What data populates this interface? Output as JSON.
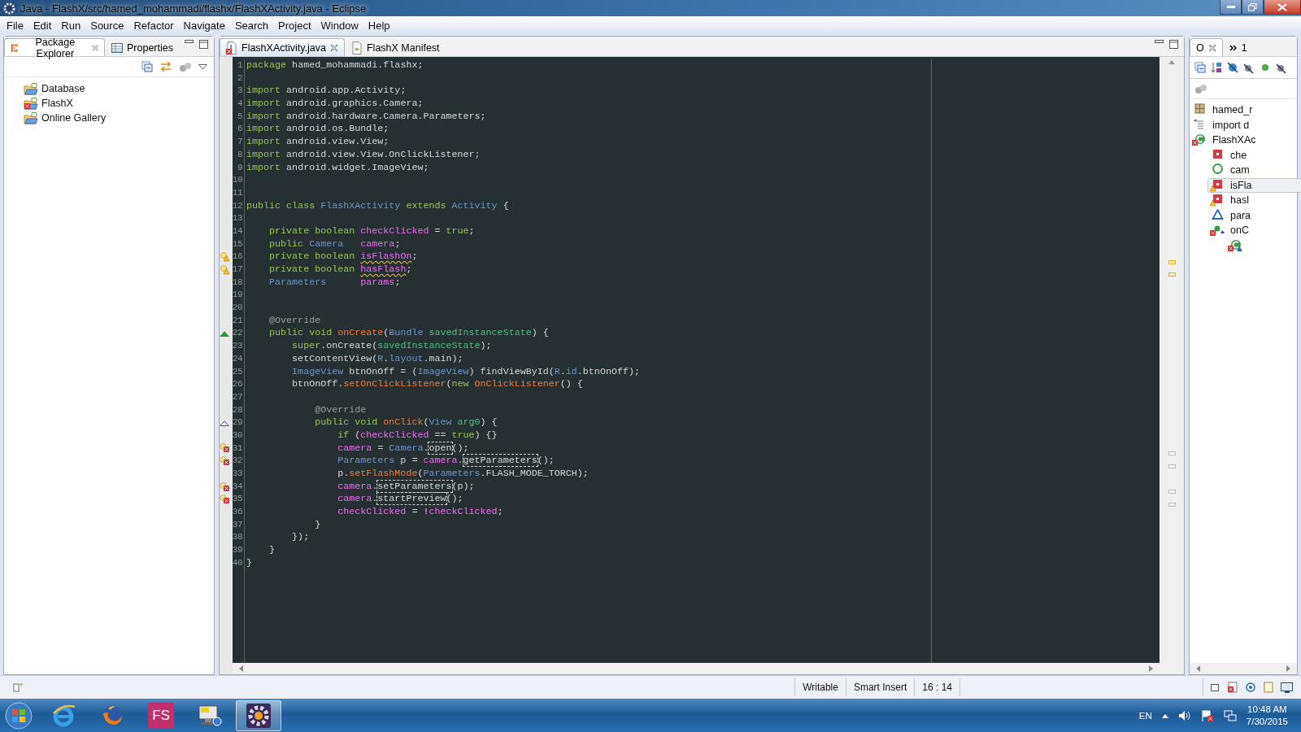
{
  "window": {
    "title": "Java - FlashX/src/hamed_mohammadi/flashx/FlashXActivity.java - Eclipse"
  },
  "menu": [
    "File",
    "Edit",
    "Run",
    "Source",
    "Refactor",
    "Navigate",
    "Search",
    "Project",
    "Window",
    "Help"
  ],
  "left_tabs": [
    {
      "label": "Package Explorer",
      "selected": true,
      "kind": "explorer"
    },
    {
      "label": "Properties",
      "selected": false,
      "kind": "properties"
    }
  ],
  "projects": [
    {
      "label": "Database",
      "error": false
    },
    {
      "label": "FlashX",
      "error": true
    },
    {
      "label": "Online Gallery",
      "error": false
    }
  ],
  "editor_tabs": [
    {
      "label": "FlashXActivity.java",
      "selected": true,
      "kind": "java",
      "error": true
    },
    {
      "label": "FlashX Manifest",
      "selected": false,
      "kind": "manifest",
      "error": false
    }
  ],
  "code": [
    {
      "n": "1",
      "tokens": [
        {
          "kind": "kw",
          "text": "package"
        },
        {
          "kind": "txt",
          "text": " hamed_mohammadi.flashx;"
        }
      ]
    },
    {
      "n": "2"
    },
    {
      "n": "3",
      "tokens": [
        {
          "kind": "kw",
          "text": "import"
        },
        {
          "kind": "txt",
          "text": " android.app.Activity;"
        }
      ]
    },
    {
      "n": "4",
      "tokens": [
        {
          "kind": "kw",
          "text": "import"
        },
        {
          "kind": "txt",
          "text": " android.graphics.Camera;"
        }
      ]
    },
    {
      "n": "5",
      "tokens": [
        {
          "kind": "kw",
          "text": "import"
        },
        {
          "kind": "txt",
          "text": " android.hardware.Camera.Parameters;"
        }
      ]
    },
    {
      "n": "6",
      "tokens": [
        {
          "kind": "kw",
          "text": "import"
        },
        {
          "kind": "txt",
          "text": " android.os.Bundle;"
        }
      ]
    },
    {
      "n": "7",
      "tokens": [
        {
          "kind": "kw",
          "text": "import"
        },
        {
          "kind": "txt",
          "text": " android.view.View;"
        }
      ]
    },
    {
      "n": "8",
      "tokens": [
        {
          "kind": "kw",
          "text": "import"
        },
        {
          "kind": "txt",
          "text": " android.view.View.OnClickListener;"
        }
      ]
    },
    {
      "n": "9",
      "tokens": [
        {
          "kind": "kw",
          "text": "import"
        },
        {
          "kind": "txt",
          "text": " android.widget.ImageView;"
        }
      ]
    },
    {
      "n": "10"
    },
    {
      "n": "11"
    },
    {
      "n": "12",
      "tokens": [
        {
          "kind": "kw",
          "text": "public class "
        },
        {
          "kind": "type",
          "text": "FlashXActivity"
        },
        {
          "kind": "kw",
          "text": " extends "
        },
        {
          "kind": "type",
          "text": "Activity"
        },
        {
          "kind": "txt",
          "text": " {"
        }
      ]
    },
    {
      "n": "13"
    },
    {
      "n": "14",
      "tokens": [
        {
          "kind": "kw",
          "text": "    private boolean "
        },
        {
          "kind": "field",
          "text": "checkClicked"
        },
        {
          "kind": "txt",
          "text": " = "
        },
        {
          "kind": "kw",
          "text": "true"
        },
        {
          "kind": "txt",
          "text": ";"
        }
      ]
    },
    {
      "n": "15",
      "tokens": [
        {
          "kind": "kw",
          "text": "    public "
        },
        {
          "kind": "type",
          "text": "Camera"
        },
        {
          "kind": "field",
          "text": "   camera"
        },
        {
          "kind": "txt",
          "text": ";"
        }
      ]
    },
    {
      "n": "16",
      "kind": "warning",
      "tokens": [
        {
          "kind": "kw",
          "text": "    private boolean "
        },
        {
          "kind": "field",
          "text": "isFlashOn",
          "squiggle": true
        },
        {
          "kind": "txt",
          "text": ";"
        }
      ]
    },
    {
      "n": "17",
      "kind": "warning",
      "tokens": [
        {
          "kind": "kw",
          "text": "    private boolean "
        },
        {
          "kind": "field",
          "text": "hasFlash",
          "squiggle": true
        },
        {
          "kind": "txt",
          "text": ";"
        }
      ]
    },
    {
      "n": "18",
      "tokens": [
        {
          "kind": "type",
          "text": "    Parameters"
        },
        {
          "kind": "field",
          "text": "      params"
        },
        {
          "kind": "txt",
          "text": ";"
        }
      ]
    },
    {
      "n": "19"
    },
    {
      "n": "20"
    },
    {
      "n": "21",
      "tokens": [
        {
          "kind": "ann",
          "text": "    @Override"
        }
      ]
    },
    {
      "n": "22",
      "kind": "override",
      "tokens": [
        {
          "kind": "kw",
          "text": "    public void "
        },
        {
          "kind": "method",
          "text": "onCreate"
        },
        {
          "kind": "txt",
          "text": "("
        },
        {
          "kind": "type",
          "text": "Bundle "
        },
        {
          "kind": "param",
          "text": "savedInstanceState"
        },
        {
          "kind": "txt",
          "text": ") {"
        }
      ]
    },
    {
      "n": "23",
      "tokens": [
        {
          "kind": "kw",
          "text": "        super"
        },
        {
          "kind": "txt",
          "text": ".onCreate("
        },
        {
          "kind": "param",
          "text": "savedInstanceState"
        },
        {
          "kind": "txt",
          "text": ");"
        }
      ]
    },
    {
      "n": "24",
      "tokens": [
        {
          "kind": "txt",
          "text": "        setContentView("
        },
        {
          "kind": "type",
          "text": "R"
        },
        {
          "kind": "txt",
          "text": "."
        },
        {
          "kind": "type",
          "text": "layout"
        },
        {
          "kind": "txt",
          "text": ".main);"
        }
      ]
    },
    {
      "n": "25",
      "tokens": [
        {
          "kind": "type",
          "text": "        ImageView"
        },
        {
          "kind": "txt",
          "text": " btnOnOff = ("
        },
        {
          "kind": "type",
          "text": "ImageView"
        },
        {
          "kind": "txt",
          "text": ") findViewById("
        },
        {
          "kind": "type",
          "text": "R"
        },
        {
          "kind": "txt",
          "text": "."
        },
        {
          "kind": "type",
          "text": "id"
        },
        {
          "kind": "txt",
          "text": ".btnOnOff);"
        }
      ]
    },
    {
      "n": "26",
      "tokens": [
        {
          "kind": "txt",
          "text": "        btnOnOff."
        },
        {
          "kind": "method",
          "text": "setOnClickListener"
        },
        {
          "kind": "txt",
          "text": "("
        },
        {
          "kind": "kw",
          "text": "new "
        },
        {
          "kind": "method",
          "text": "OnClickListener"
        },
        {
          "kind": "txt",
          "text": "() {"
        }
      ]
    },
    {
      "n": "27"
    },
    {
      "n": "28",
      "tokens": [
        {
          "kind": "ann",
          "text": "            @Override"
        }
      ]
    },
    {
      "n": "29",
      "kind": "implements",
      "tokens": [
        {
          "kind": "kw",
          "text": "            public void "
        },
        {
          "kind": "method",
          "text": "onClick"
        },
        {
          "kind": "txt",
          "text": "("
        },
        {
          "kind": "type",
          "text": "View "
        },
        {
          "kind": "param",
          "text": "arg0"
        },
        {
          "kind": "txt",
          "text": ") {"
        }
      ]
    },
    {
      "n": "30",
      "tokens": [
        {
          "kind": "kw",
          "text": "                if "
        },
        {
          "kind": "txt",
          "text": "("
        },
        {
          "kind": "field",
          "text": "checkClicked"
        },
        {
          "kind": "txt",
          "text": " == "
        },
        {
          "kind": "kw",
          "text": "true"
        },
        {
          "kind": "txt",
          "text": ") {}"
        }
      ]
    },
    {
      "n": "31",
      "kind": "error",
      "tokens": [
        {
          "kind": "field",
          "text": "                camera"
        },
        {
          "kind": "txt",
          "text": " = "
        },
        {
          "kind": "type",
          "text": "Camera"
        },
        {
          "kind": "txt",
          "text": "."
        },
        {
          "kind": "txt",
          "text": "open",
          "boxed": true
        },
        {
          "kind": "txt",
          "text": "();"
        }
      ]
    },
    {
      "n": "32",
      "kind": "error",
      "tokens": [
        {
          "kind": "type",
          "text": "                Parameters"
        },
        {
          "kind": "txt",
          "text": " p = "
        },
        {
          "kind": "field",
          "text": "camera"
        },
        {
          "kind": "txt",
          "text": "."
        },
        {
          "kind": "txt",
          "text": "getParameters",
          "boxed": true
        },
        {
          "kind": "txt",
          "text": "();"
        }
      ]
    },
    {
      "n": "33",
      "tokens": [
        {
          "kind": "txt",
          "text": "                p."
        },
        {
          "kind": "method",
          "text": "setFlashMode"
        },
        {
          "kind": "txt",
          "text": "("
        },
        {
          "kind": "type",
          "text": "Parameters"
        },
        {
          "kind": "txt",
          "text": ".FLASH_MODE_TORCH);"
        }
      ]
    },
    {
      "n": "34",
      "kind": "error",
      "tokens": [
        {
          "kind": "field",
          "text": "                camera"
        },
        {
          "kind": "txt",
          "text": "."
        },
        {
          "kind": "txt",
          "text": "setParameters",
          "boxed": true
        },
        {
          "kind": "txt",
          "text": "(p);"
        }
      ]
    },
    {
      "n": "35",
      "kind": "error",
      "tokens": [
        {
          "kind": "field",
          "text": "                camera"
        },
        {
          "kind": "txt",
          "text": "."
        },
        {
          "kind": "txt",
          "text": "startPreview",
          "boxed": true
        },
        {
          "kind": "txt",
          "text": "();"
        }
      ]
    },
    {
      "n": "36",
      "tokens": [
        {
          "kind": "field",
          "text": "                checkClicked"
        },
        {
          "kind": "txt",
          "text": " = !"
        },
        {
          "kind": "field",
          "text": "checkClicked"
        },
        {
          "kind": "txt",
          "text": ";"
        }
      ]
    },
    {
      "n": "37",
      "tokens": [
        {
          "kind": "txt",
          "text": "            }"
        }
      ]
    },
    {
      "n": "38",
      "tokens": [
        {
          "kind": "txt",
          "text": "        });"
        }
      ]
    },
    {
      "n": "39",
      "tokens": [
        {
          "kind": "txt",
          "text": "    }"
        }
      ]
    },
    {
      "n": "40",
      "tokens": [
        {
          "kind": "txt",
          "text": "}"
        }
      ]
    }
  ],
  "right_tabs": [
    {
      "label": "O",
      "selected": true,
      "kind": "outline"
    },
    {
      "label": "1",
      "selected": false,
      "kind": "overflow"
    }
  ],
  "outline": [
    {
      "label": "hamed_r",
      "kind": "package",
      "selected": false
    },
    {
      "label": "import d",
      "kind": "imports",
      "selected": false
    },
    {
      "label": "FlashXAc",
      "kind": "class",
      "selected": false,
      "error": true,
      "children": [
        {
          "label": "che",
          "kind": "private",
          "selected": false
        },
        {
          "label": "cam",
          "kind": "public",
          "selected": false
        },
        {
          "label": "isFla",
          "kind": "private",
          "selected": true,
          "warning": true
        },
        {
          "label": "hasl",
          "kind": "private",
          "selected": false,
          "warning": true
        },
        {
          "label": "para",
          "kind": "default",
          "selected": false
        },
        {
          "label": "onC",
          "kind": "method",
          "selected": false,
          "error": true,
          "children": [
            {
              "kind": "anonymous",
              "selected": false,
              "error": true
            }
          ]
        }
      ]
    }
  ],
  "status_bar": [
    "Writable",
    "Smart Insert",
    "16 : 14"
  ],
  "taskbar": {
    "apps": [
      {
        "kind": "ie",
        "selected": false
      },
      {
        "kind": "firefox",
        "selected": false
      },
      {
        "kind": "fs",
        "label": "FS",
        "selected": false
      },
      {
        "kind": "monitor",
        "selected": false
      },
      {
        "kind": "eclipse",
        "selected": true
      }
    ],
    "language": "EN",
    "time": "10:48 AM",
    "date": "7/30/2015"
  }
}
